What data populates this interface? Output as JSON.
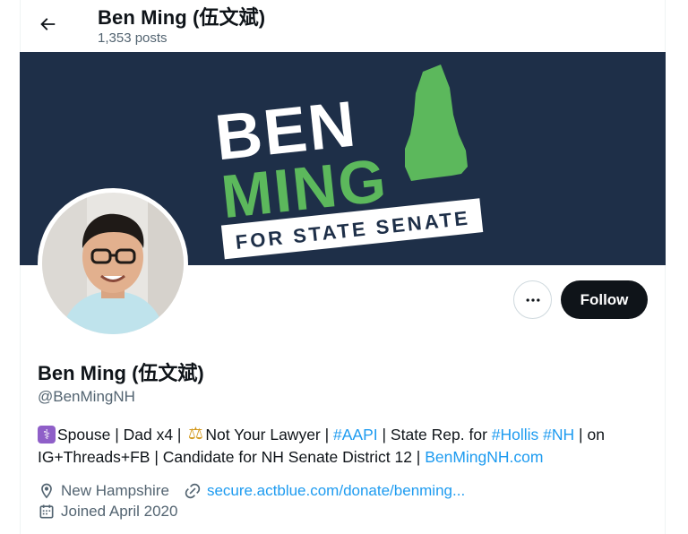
{
  "header": {
    "back_icon": "arrow-left-icon",
    "name": "Ben Ming (伍文斌)",
    "posts": "1,353 posts"
  },
  "banner": {
    "line1": "BEN",
    "line2": "MING",
    "tagline": "FOR STATE SENATE",
    "colors": {
      "background": "#1e2f48",
      "green": "#5cb85c",
      "white": "#ffffff"
    }
  },
  "actions": {
    "more_icon": "more-horizontal-icon",
    "follow_label": "Follow"
  },
  "profile": {
    "display_name": "Ben Ming (伍文斌)",
    "handle": "@BenMingNH",
    "bio": {
      "p1": "Spouse | Dad x4 | ",
      "p2": "Not Your Lawyer | ",
      "tag_aapi": "#AAPI",
      "p3": " | State Rep. for ",
      "tag_hollis": "#Hollis",
      "tag_nh": "#NH",
      "p4": " | on IG+Threads+FB | Candidate for NH Senate District 12 | ",
      "website": "BenMingNH.com"
    },
    "location": "New Hampshire",
    "link": "secure.actblue.com/donate/benming...",
    "joined": "Joined April 2020"
  },
  "colors": {
    "accent": "#1d9bf0",
    "text": "#0f1419",
    "secondary": "#536471"
  }
}
